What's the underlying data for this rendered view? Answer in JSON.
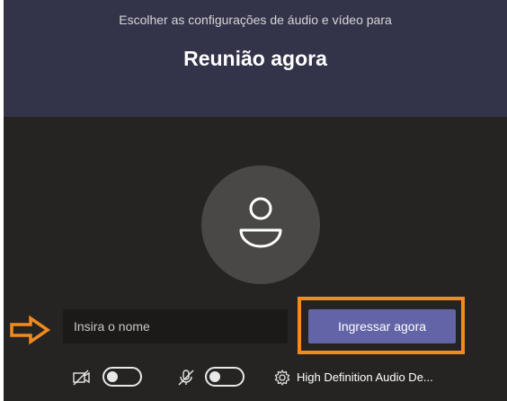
{
  "header": {
    "subtitle": "Escolher as configurações de áudio e vídeo para",
    "title": "Reunião agora"
  },
  "avatar": {
    "icon": "person-icon"
  },
  "annotation": {
    "arrow_color": "#f28a1d",
    "highlight_color": "#f28a1d"
  },
  "name_input": {
    "placeholder": "Insira o nome",
    "value": ""
  },
  "join_button": {
    "label": "Ingressar agora",
    "color": "#6264a7"
  },
  "controls": {
    "camera": {
      "icon": "camera-off-icon",
      "toggle_state": "off"
    },
    "microphone": {
      "icon": "mic-off-icon",
      "toggle_state": "off"
    },
    "audio_device": {
      "icon": "gear-icon",
      "label": "High Definition Audio De..."
    }
  },
  "colors": {
    "background": "#252423",
    "header": "#33344a"
  }
}
